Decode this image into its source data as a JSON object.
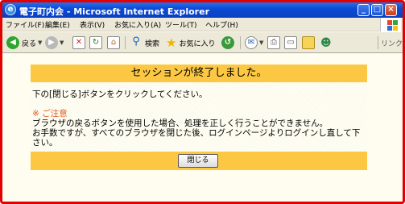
{
  "window": {
    "title": "電子町内会 - Microsoft Internet Explorer",
    "controls": {
      "minimize": "_",
      "maximize": "□",
      "close": "×"
    }
  },
  "menu": {
    "items": [
      "ファイル(F)",
      "編集(E)",
      "表示(V)",
      "お気に入り(A)",
      "ツール(T)",
      "ヘルプ(H)"
    ]
  },
  "toolbar": {
    "back_label": "戻る",
    "search_label": "検索",
    "favorites_label": "お気に入り",
    "links_label": "リンク",
    "overflow": "»"
  },
  "page": {
    "heading": "セッションが終了しました。",
    "instruction": "下の[閉じる]ボタンをクリックしてください。",
    "caution_title": "※ ご注意",
    "caution_line1": "ブラウザの戻るボタンを使用した場合、処理を正しく行うことができません。",
    "caution_line2": "お手数ですが、すべてのブラウザを閉じた後、ログインページよりログインし直して下さい。",
    "close_button": "閉じる"
  },
  "colors": {
    "panel_bar": "#fcc844",
    "caution_text": "#e25a1c",
    "window_border": "#e00000"
  }
}
